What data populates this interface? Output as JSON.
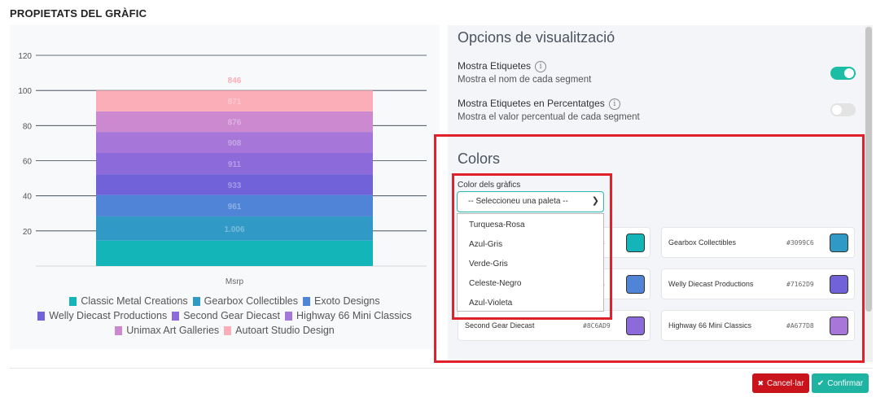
{
  "page_title": "PROPIETATS DEL GRÀFIC",
  "chart_data": {
    "type": "bar",
    "stacked": true,
    "categories": [
      "Msrp"
    ],
    "xlabel": "Msrp",
    "ylim": [
      0,
      120
    ],
    "yticks": [
      20,
      40,
      60,
      80,
      100,
      120
    ],
    "grid": true,
    "legend_position": "bottom",
    "series": [
      {
        "name": "Classic Metal Creations",
        "values": [
          14.5
        ],
        "label": "",
        "color": "#13b5b8"
      },
      {
        "name": "Gearbox Collectibles",
        "values": [
          13.8
        ],
        "label": "1.006",
        "color": "#3099c6"
      },
      {
        "name": "Exoto Designs",
        "values": [
          12.2
        ],
        "label": "961",
        "color": "#4f84d6"
      },
      {
        "name": "Welly Diecast Productions",
        "values": [
          11.8
        ],
        "label": "933",
        "color": "#7162d9"
      },
      {
        "name": "Second Gear Diecast",
        "values": [
          12.1
        ],
        "label": "911",
        "color": "#8c6ad9"
      },
      {
        "name": "Highway 66 Mini Classics",
        "values": [
          12.0
        ],
        "label": "908",
        "color": "#a677d8"
      },
      {
        "name": "Unimax Art Galleries",
        "values": [
          11.7
        ],
        "label": "876",
        "color": "#cc89cf"
      },
      {
        "name": "Autoart Studio Design",
        "values": [
          11.9
        ],
        "label": "871",
        "color": "#fcaeb8"
      }
    ],
    "top_label": "846"
  },
  "display_options": {
    "title": "Opcions de visualització",
    "show_labels": {
      "label": "Mostra Etiquetes",
      "description": "Mostra el nom de cada segment",
      "enabled": true
    },
    "show_percent": {
      "label": "Mostra Etiquetes en Percentatges",
      "description": "Mostra el valor percentual de cada segment",
      "enabled": false
    },
    "info_icon": "info-icon"
  },
  "colors": {
    "title": "Colors",
    "field_label": "Color dels gràfics",
    "select_placeholder": "-- Seleccioneu una paleta --",
    "palette_options": [
      "Turquesa-Rosa",
      "Azul-Gris",
      "Verde-Gris",
      "Celeste-Negro",
      "Azul-Violeta"
    ],
    "cards": [
      {
        "name": "",
        "hex": "#13B5B8",
        "hex_visible": "8",
        "color": "#13b5b8"
      },
      {
        "name": "Gearbox Collectibles",
        "hex": "#3099C6",
        "color": "#3099c6"
      },
      {
        "name": "",
        "hex": "#4F84D6",
        "hex_visible": "6",
        "color": "#4f84d6"
      },
      {
        "name": "Welly Diecast Productions",
        "hex": "#7162D9",
        "color": "#7162d9"
      },
      {
        "name": "Second Gear Diecast",
        "hex": "#8C6AD9",
        "color": "#8c6ad9"
      },
      {
        "name": "Highway 66 Mini Classics",
        "hex": "#A677D8",
        "color": "#a677d8"
      }
    ]
  },
  "buttons": {
    "cancel": "Cancel·lar",
    "confirm": "Confirmar"
  },
  "accent_colors": {
    "toggle_on": "#1bbda4",
    "highlight": "#e0202a",
    "cancel": "#c9141b",
    "confirm": "#1fb3a2"
  }
}
